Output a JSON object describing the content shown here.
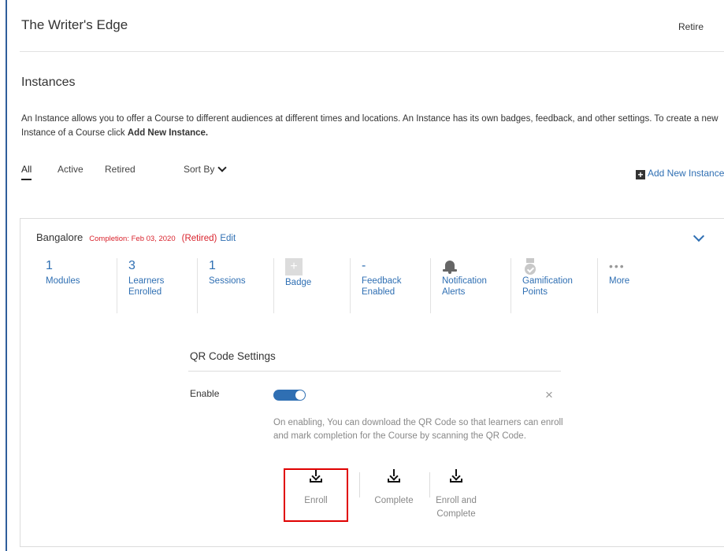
{
  "header": {
    "title": "The Writer's Edge",
    "retire_label": "Retire"
  },
  "instances": {
    "title": "Instances",
    "description_pre": "An Instance allows you to offer a Course to different audiences at different times and locations. An Instance has its own badges, feedback, and other settings. To create a new Instance of a Course click ",
    "description_bold": "Add New Instance."
  },
  "filters": {
    "tabs": [
      {
        "label": "All"
      },
      {
        "label": "Active"
      },
      {
        "label": "Retired"
      }
    ],
    "sort_label": "Sort By",
    "add_new_label": "Add New Instance"
  },
  "instance": {
    "name": "Bangalore",
    "completion": "Completion: Feb 03, 2020",
    "status": "(Retired)",
    "edit_label": "Edit",
    "stats": [
      {
        "value": "1",
        "label": "Modules"
      },
      {
        "value": "3",
        "label": "Learners Enrolled"
      },
      {
        "value": "1",
        "label": "Sessions"
      },
      {
        "value": "+",
        "label": "Badge",
        "icon": "add-badge-icon"
      },
      {
        "value": "-",
        "label": "Feedback Enabled"
      },
      {
        "label": "Notification Alerts",
        "icon": "bell-icon"
      },
      {
        "label": "Gamification Points",
        "icon": "medal-icon"
      },
      {
        "value": "•••",
        "label": "More",
        "icon": "more-icon"
      }
    ]
  },
  "qr": {
    "title": "QR Code Settings",
    "enable_label": "Enable",
    "enabled": true,
    "description": "On enabling, You can download the QR Code so that learners can enroll and mark completion for the Course by scanning the QR Code.",
    "downloads": [
      {
        "label": "Enroll"
      },
      {
        "label": "Complete"
      },
      {
        "label": "Enroll and Complete"
      }
    ]
  },
  "colors": {
    "accent": "#2f6fb3",
    "alert": "#d9232d",
    "highlight": "#e00000"
  }
}
